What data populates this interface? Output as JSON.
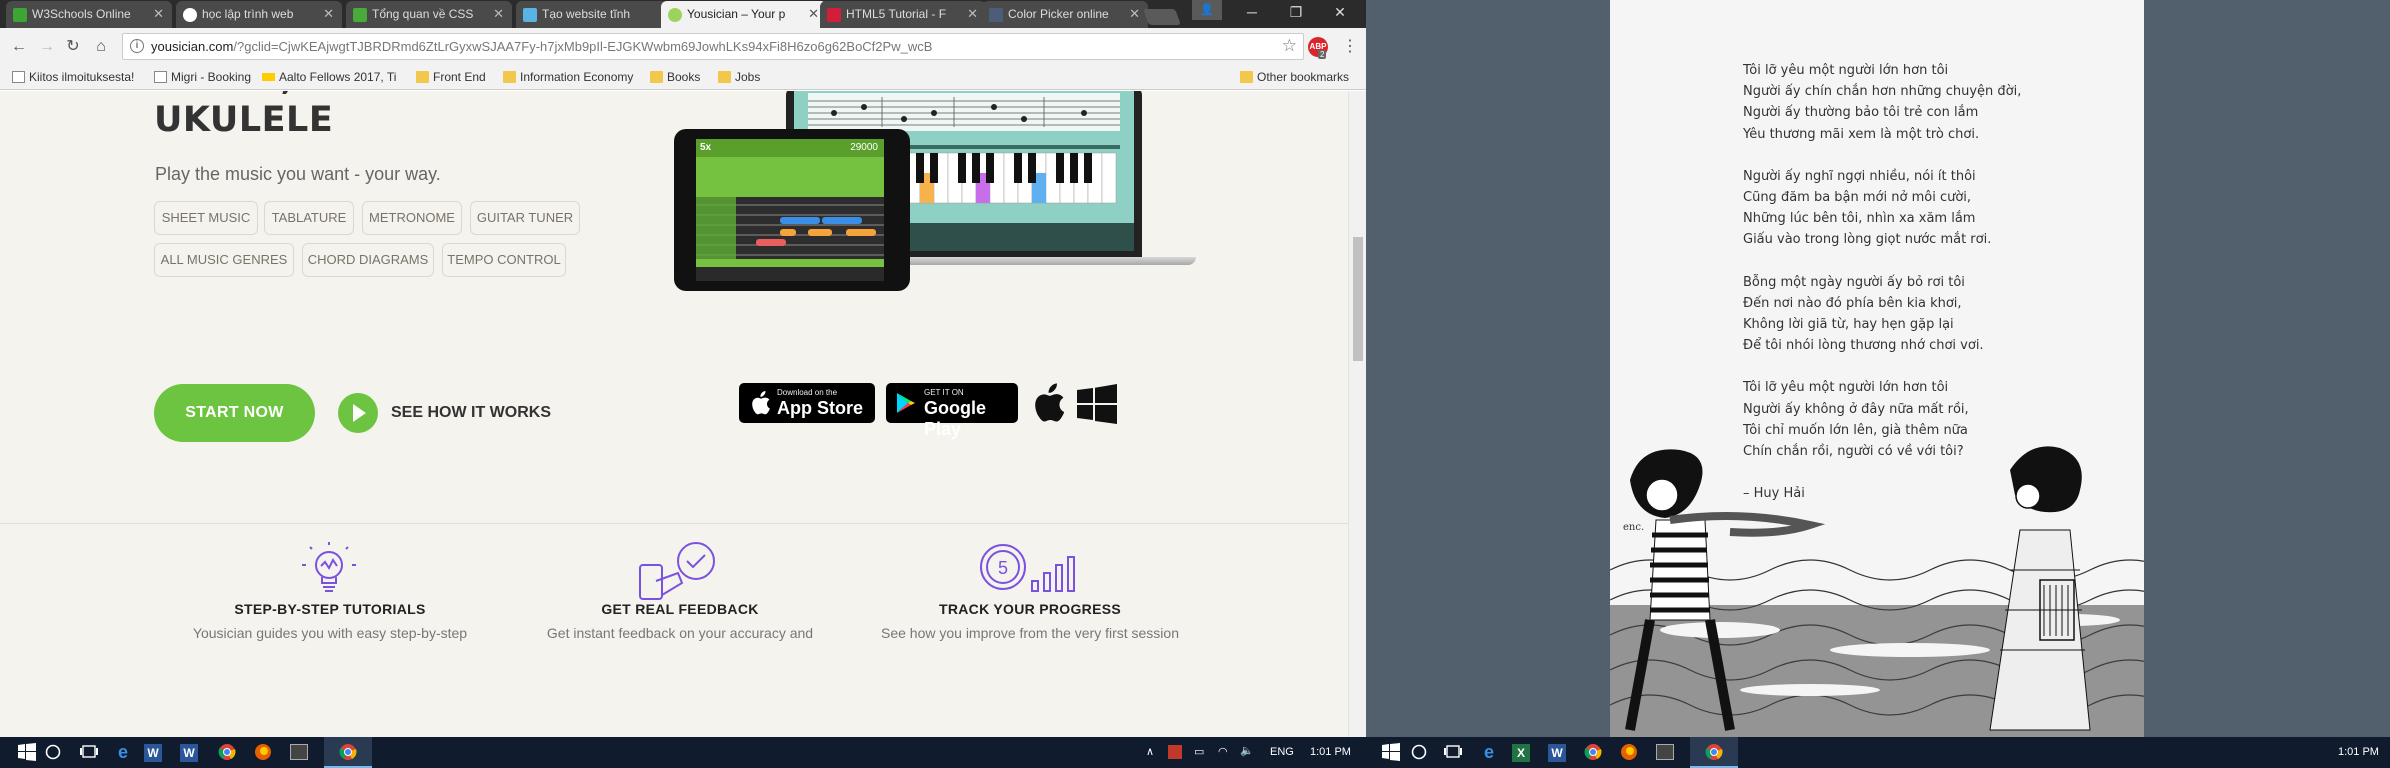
{
  "browser": {
    "tabs": [
      {
        "label": "W3Schools Online",
        "favicon_color": "#3ca535"
      },
      {
        "label": "học lập trình web",
        "favicon_color": "#ffffff"
      },
      {
        "label": "Tổng quan về CSS",
        "favicon_color": "#4bab3a"
      },
      {
        "label": "Tạo website tĩnh",
        "favicon_color": "#5ab3e5"
      },
      {
        "label": "Yousician – Your p",
        "favicon_color": "#9cd35e"
      },
      {
        "label": "HTML5 Tutorial - F",
        "favicon_color": "#d11f3a"
      },
      {
        "label": "Color Picker online",
        "favicon_color": "#4c5d7a"
      }
    ],
    "url_domain": "yousician.com",
    "url_rest": "/?gclid=CjwKEAjwgtTJBRDRmd6ZtLrGyxwSJAA7Fy-h7jxMb9pIl-EJGKWwbm69JowhLKs94xFi8H6zo6g62BoCf2Pw_wcB",
    "adblock_count": "2",
    "bookmarks": [
      {
        "label": "Kiitos ilmoituksesta!",
        "icon": "page-icon"
      },
      {
        "label": "Migri - Booking",
        "icon": "page-icon"
      },
      {
        "label": "Aalto Fellows 2017, Ti",
        "icon": "aalto-icon"
      },
      {
        "label": "Front End",
        "icon": "folder-icon"
      },
      {
        "label": "Information Economy",
        "icon": "folder-icon"
      },
      {
        "label": "Books",
        "icon": "folder-icon"
      },
      {
        "label": "Jobs",
        "icon": "folder-icon"
      }
    ],
    "other_bookmarks": "Other bookmarks"
  },
  "page": {
    "hero_title": "PIANO, BASS AND\nUKULELE",
    "subtitle": "Play the music you want - your way.",
    "tags_row1": [
      "SHEET MUSIC",
      "TABLATURE",
      "METRONOME",
      "GUITAR TUNER"
    ],
    "tags_row2": [
      "ALL MUSIC GENRES",
      "CHORD DIAGRAMS",
      "TEMPO CONTROL"
    ],
    "start_button": "START NOW",
    "see_how": "SEE HOW IT WORKS",
    "app_store_small": "Download on the",
    "app_store_big": "App Store",
    "google_play_small": "GET IT ON",
    "google_play_big": "Google Play",
    "tablet_score": "29000",
    "tablet_multiplier": "5x",
    "features": [
      {
        "title": "STEP-BY-STEP TUTORIALS",
        "desc": "Yousician guides you with easy step-by-step"
      },
      {
        "title": "GET REAL FEEDBACK",
        "desc": "Get instant feedback on your accuracy and"
      },
      {
        "title": "TRACK YOUR PROGRESS",
        "desc": "See how you improve from the very first session"
      }
    ],
    "accent_color": "#6cc440",
    "icon_color": "#7b52e0"
  },
  "taskbar_left": {
    "language": "ENG",
    "time": "1:01 PM"
  },
  "taskbar_right": {
    "time": "1:01 PM"
  },
  "poem": {
    "stanzas": [
      [
        "Tôi lỡ yêu một người lớn hơn tôi",
        "Người ấy chín chắn hơn những chuyện đời,",
        "Người ấy thường bảo tôi trẻ con lắm",
        "Yêu thương mãi xem là một trò chơi."
      ],
      [
        "Người ấy nghĩ ngợi nhiều, nói ít thôi",
        "Cũng đăm ba bận mới nở môi cười,",
        "Những lúc bên tôi, nhìn xa xăm lắm",
        "Giấu vào trong lòng giọt nước mắt rơi."
      ],
      [
        "Bỗng một ngày người ấy bỏ rơi tôi",
        "Đến nơi nào đó phía bên kia khơi,",
        "Không lời giã từ, hay hẹn gặp lại",
        "Để tôi nhói lòng thương nhớ chơi vơi."
      ],
      [
        "Tôi lỡ yêu một người lớn hơn tôi",
        "Người ấy không ở đây nữa mất rồi,",
        "Tôi chỉ muốn lớn lên, già thêm nữa",
        "Chín chắn rồi, người có về với tôi?"
      ]
    ],
    "author": "– Huy Hải",
    "signature": "enc."
  }
}
